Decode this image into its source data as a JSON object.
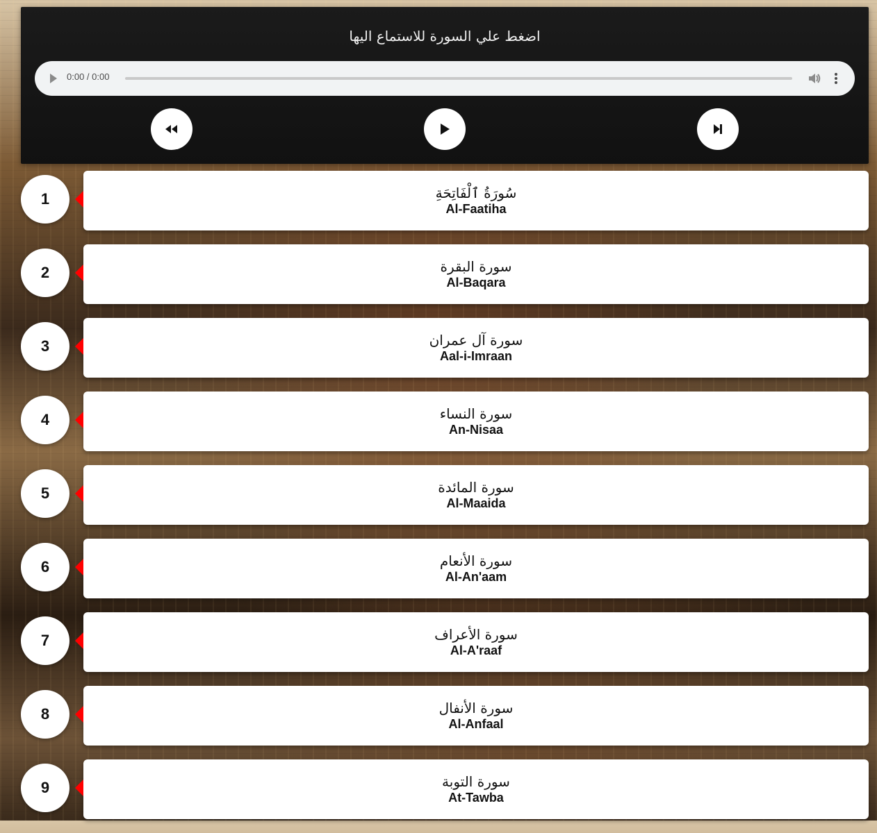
{
  "player": {
    "title": "اضغط علي السورة للاستماع اليها",
    "audio": {
      "time": "0:00 / 0:00",
      "progress": 0
    },
    "controls": {
      "prev_icon": "rewind-icon",
      "play_icon": "play-icon",
      "next_icon": "skip-next-icon"
    }
  },
  "surahs": [
    {
      "number": "1",
      "arabic": "سُورَةُ ٱلْفَاتِحَةِ",
      "english": "Al-Faatiha"
    },
    {
      "number": "2",
      "arabic": "سورة البقرة",
      "english": "Al-Baqara"
    },
    {
      "number": "3",
      "arabic": "سورة آل عمران",
      "english": "Aal-i-Imraan"
    },
    {
      "number": "4",
      "arabic": "سورة النساء",
      "english": "An-Nisaa"
    },
    {
      "number": "5",
      "arabic": "سورة المائدة",
      "english": "Al-Maaida"
    },
    {
      "number": "6",
      "arabic": "سورة الأنعام",
      "english": "Al-An'aam"
    },
    {
      "number": "7",
      "arabic": "سورة الأعراف",
      "english": "Al-A'raaf"
    },
    {
      "number": "8",
      "arabic": "سورة الأنفال",
      "english": "Al-Anfaal"
    },
    {
      "number": "9",
      "arabic": "سورة التوبة",
      "english": "At-Tawba"
    }
  ],
  "colors": {
    "arrow": "#ff0000",
    "player_bg": "#111111",
    "card_bg": "#ffffff"
  }
}
